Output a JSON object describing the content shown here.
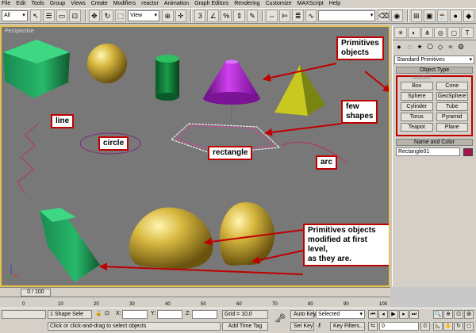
{
  "menu": [
    "File",
    "Edit",
    "Tools",
    "Group",
    "Views",
    "Create",
    "Modifiers",
    "reactor",
    "Animation",
    "Graph Editors",
    "Rendering",
    "Customize",
    "MAXScript",
    "Help"
  ],
  "toolbar": {
    "selection_filter": "All",
    "ref_coord": "View",
    "named_selection": ""
  },
  "viewport": {
    "label": "Perspective"
  },
  "callouts": {
    "primitives": "Primitives\nobjects",
    "few_shapes": "few\nshapes",
    "line": "line",
    "circle": "circle",
    "rectangle": "rectangle",
    "arc": "arc",
    "modified": "Primitives objects\nmodified at first\nlevel,\nas they are."
  },
  "command_panel": {
    "category": "Standard Primitives",
    "object_type_header": "Object Type",
    "autogrid": "AutoGrid",
    "buttons": [
      "Box",
      "Cone",
      "Sphere",
      "GeoSphere",
      "Cylinder",
      "Tube",
      "Torus",
      "Pyramid",
      "Teapot",
      "Plane"
    ],
    "name_color_header": "Name and Color",
    "object_name": "Rectangle01",
    "object_color": "#a0194a"
  },
  "timeline": {
    "frame": "0 / 100",
    "ticks": [
      "0",
      "10",
      "20",
      "30",
      "40",
      "50",
      "60",
      "70",
      "80",
      "90",
      "100"
    ]
  },
  "status": {
    "selection": "1 Shape Sele",
    "x_label": "X:",
    "y_label": "Y:",
    "z_label": "Z:",
    "grid": "Grid = 10,0",
    "prompt": "Click or click-and-drag to select objects",
    "add_time_tag": "Add Time Tag",
    "auto_key": "Auto Key",
    "set_key": "Set Key",
    "key_mode": "Selected",
    "key_filters": "Key Filters...",
    "frame_field": "0"
  },
  "colors": {
    "accent_red": "#c00000",
    "viewport_bg": "#787878",
    "active_border": "#e8c34a"
  }
}
